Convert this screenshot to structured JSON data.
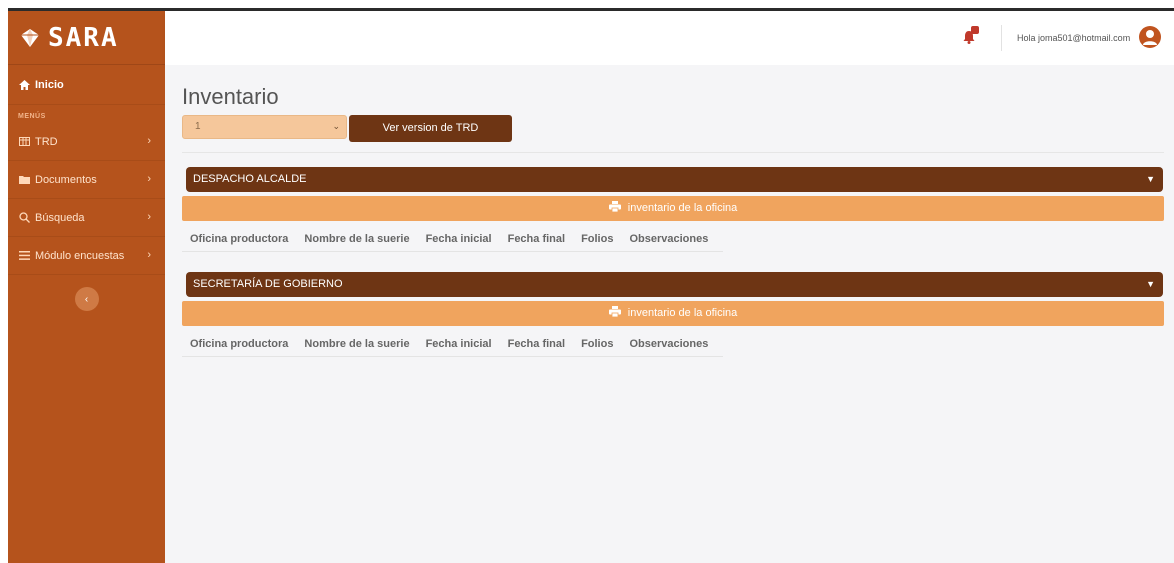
{
  "app": {
    "brand": "SARA"
  },
  "sidebar": {
    "home_label": "Inicio",
    "section_label": "MENÚS",
    "items": [
      {
        "label": "TRD",
        "icon": "table-icon"
      },
      {
        "label": "Documentos",
        "icon": "folder-icon"
      },
      {
        "label": "Búsqueda",
        "icon": "search-icon"
      },
      {
        "label": "Módulo encuestas",
        "icon": "list-icon"
      }
    ]
  },
  "header": {
    "greeting": "Hola joma501@hotmail.com"
  },
  "main": {
    "title": "Inventario",
    "version_select_value": "1",
    "version_button": "Ver version de TRD",
    "offices": [
      {
        "name": "DESPACHO ALCALDE",
        "inventory_button": "inventario de la oficina",
        "columns": [
          "Oficina productora",
          "Nombre de la suerie",
          "Fecha inicial",
          "Fecha final",
          "Folios",
          "Observaciones"
        ]
      },
      {
        "name": "SECRETARÍA DE GOBIERNO",
        "inventory_button": "inventario de la oficina",
        "columns": [
          "Oficina productora",
          "Nombre de la suerie",
          "Fecha inicial",
          "Fecha final",
          "Folios",
          "Observaciones"
        ]
      }
    ]
  },
  "colors": {
    "sidebar": "#b5531c",
    "primary_dark": "#6e3514",
    "accent_orange": "#f0a45e",
    "select_bg": "#f5c79b"
  }
}
